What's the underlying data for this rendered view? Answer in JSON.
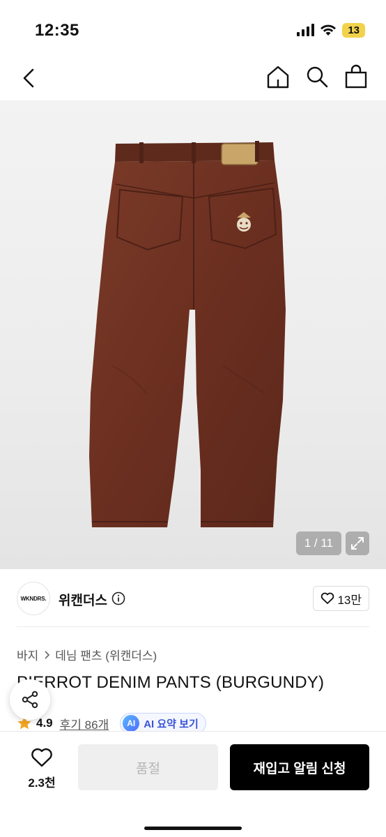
{
  "status_bar": {
    "time": "12:35",
    "battery": "13",
    "icons": [
      "cellular-signal-icon",
      "wifi-icon",
      "battery-icon"
    ]
  },
  "nav": {
    "icons": [
      "back-chevron-icon",
      "home-icon",
      "search-icon",
      "shopping-bag-icon"
    ]
  },
  "gallery": {
    "counter": "1 / 11",
    "image_subject": "burgundy denim pants, back view"
  },
  "brand": {
    "logo_text": "WKNDRS.",
    "name": "위캔더스",
    "likes": "13만"
  },
  "category": {
    "level1": "바지",
    "level2": "데님 팬츠 (위캔더스)"
  },
  "product": {
    "title": "PIERROT DENIM PANTS (BURGUNDY)",
    "rating": "4.9",
    "reviews": "후기 86개",
    "ai_badge": "AI",
    "ai_summary": "AI 요약 보기"
  },
  "bottom": {
    "wish_count": "2.3천",
    "soldout_label": "품절",
    "restock_label": "재입고 알림 신청"
  },
  "colors": {
    "accent_star": "#f5a623",
    "ai_blue": "#3a55d8",
    "pants_burgundy": "#6e3222",
    "cta_black": "#000000"
  }
}
